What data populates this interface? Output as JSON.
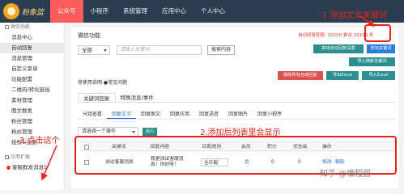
{
  "app": {
    "logo_text": "粉象篮"
  },
  "topnav": [
    "公众号",
    "小程序",
    "系统管理",
    "应用中心",
    "个人中心"
  ],
  "sidebar": {
    "group1": "微信功能",
    "items1": [
      "消息中心",
      "自动回复",
      "消息管理",
      "自定义菜单",
      "功能配置",
      "二维码/转化链接",
      "素材管理",
      "图文群发",
      "粉丝管理"
    ],
    "items2": [
      "粉丝管理",
      "授权&注册"
    ],
    "group2": "应用扩展",
    "ext_item": "客服群发消息S"
  },
  "main": {
    "title": "微信功能",
    "quota": "自动回复配额: 20200 剩余 20199 条",
    "filter_select": "全部",
    "keyword_placeholder": "请输入关键词",
    "search_button": "搜索内容",
    "btn_advanced": "高级自动回复设置",
    "btn_add_keyword": "增加关键词",
    "btn_import_keyword": "导入撩欧关键词",
    "btn_delete_all": "删除所有自动回复",
    "btn_export_excel": "导出Excel",
    "btn_import_excel": "导入Excel",
    "help_text": "常使用说明 ●常见问题",
    "tabs": [
      "关键词回复",
      "特殊消息/事件"
    ],
    "subtabs": [
      "分组查看",
      "回复文字",
      "回复图文",
      "回复应用",
      "回复语音",
      "回复图片",
      "回复小程序"
    ],
    "batch_select": "请选择一个操作",
    "execute_button": "执行"
  },
  "table": {
    "headers": [
      "关键词",
      "回复内容",
      "匹配规则",
      "会员",
      "积分",
      "优先级",
      "操作"
    ],
    "rows": [
      {
        "keyword": "测试客服消息",
        "reply": "我是测试客服消息！你好呀！",
        "match_rule": "全匹配",
        "member": "否",
        "points": "0",
        "priority": "0",
        "edit": "修改",
        "delete": "删除"
      }
    ]
  },
  "annotations": {
    "a1": "1.添加文本关键词",
    "a2": "2.添加后列表里会显示",
    "a3": "3.点击这个"
  },
  "watermark": "知乎 @编程菌",
  "colors": {
    "topbar": "#2b3e50",
    "accent": "#ff5b5b",
    "annotation": "#e5231b"
  }
}
